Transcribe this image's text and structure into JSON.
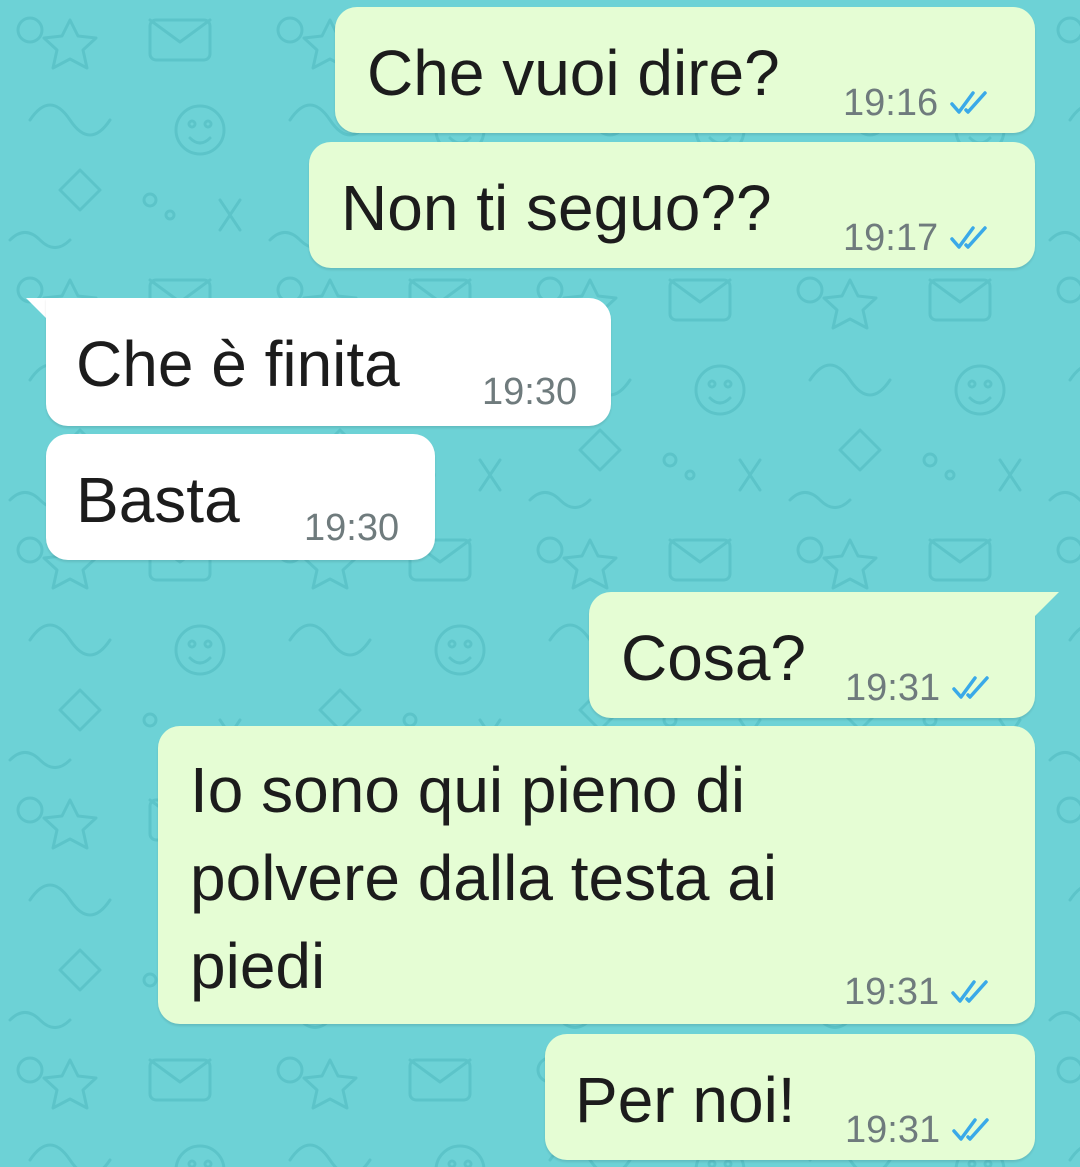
{
  "colors": {
    "background": "#6dd2d6",
    "outgoing_bubble": "#e5fdd4",
    "incoming_bubble": "#ffffff",
    "read_ticks": "#3aa9e8",
    "timestamp": "#6f7b7d"
  },
  "messages": [
    {
      "id": "m1",
      "direction": "outgoing",
      "text": "Che vuoi dire?",
      "time": "19:16",
      "status": "read-ticks-icon"
    },
    {
      "id": "m2",
      "direction": "outgoing",
      "text": "Non ti seguo??",
      "time": "19:17",
      "status": "read-ticks-icon"
    },
    {
      "id": "m3",
      "direction": "incoming",
      "text": "Che è finita",
      "time": "19:30"
    },
    {
      "id": "m4",
      "direction": "incoming",
      "text": "Basta",
      "time": "19:30"
    },
    {
      "id": "m5",
      "direction": "outgoing",
      "text": "Cosa?",
      "time": "19:31",
      "status": "read-ticks-icon"
    },
    {
      "id": "m6",
      "direction": "outgoing",
      "lines": [
        "Io sono qui pieno di",
        "polvere dalla testa ai",
        "piedi"
      ],
      "time": "19:31",
      "status": "read-ticks-icon"
    },
    {
      "id": "m7",
      "direction": "outgoing",
      "text": "Per noi!",
      "time": "19:31",
      "status": "read-ticks-icon"
    }
  ]
}
